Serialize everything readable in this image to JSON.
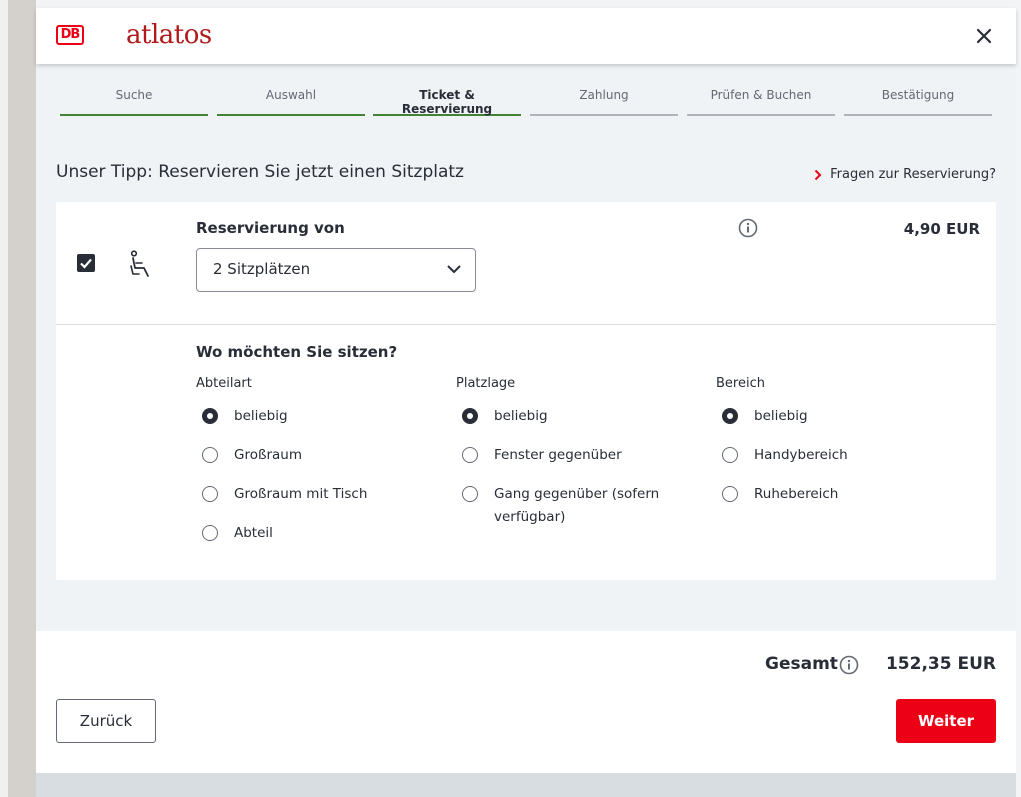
{
  "header": {
    "logo_text": "DB",
    "brand": "atlatos"
  },
  "steps": [
    {
      "label": "Suche",
      "state": "done"
    },
    {
      "label": "Auswahl",
      "state": "done"
    },
    {
      "label": "Ticket & Reservierung",
      "state": "active"
    },
    {
      "label": "Zahlung",
      "state": "pending"
    },
    {
      "label": "Prüfen & Buchen",
      "state": "pending"
    },
    {
      "label": "Bestätigung",
      "state": "pending"
    }
  ],
  "tipp": "Unser Tipp: Reservieren Sie jetzt einen Sitzplatz",
  "faq_link": "Fragen zur Reservierung?",
  "reservation": {
    "checked": true,
    "label": "Reservierung von",
    "select_value": "2 Sitzplätzen",
    "price": "4,90 EUR"
  },
  "preferences": {
    "heading": "Wo möchten Sie sitzen?",
    "abteilart": {
      "title": "Abteilart",
      "options": [
        "beliebig",
        "Großraum",
        "Großraum mit Tisch",
        "Abteil"
      ],
      "selected": "beliebig"
    },
    "platzlage": {
      "title": "Platzlage",
      "options": [
        "beliebig",
        "Fenster gegenüber",
        "Gang gegenüber (sofern verfügbar)"
      ],
      "selected": "beliebig"
    },
    "bereich": {
      "title": "Bereich",
      "options": [
        "beliebig",
        "Handybereich",
        "Ruhebereich"
      ],
      "selected": "beliebig"
    }
  },
  "footer": {
    "total_label": "Gesamt",
    "total_value": "152,35 EUR",
    "back_label": "Zurück",
    "next_label": "Weiter"
  },
  "colors": {
    "db_red": "#ec0016",
    "step_done": "#408335",
    "text": "#282d37"
  }
}
